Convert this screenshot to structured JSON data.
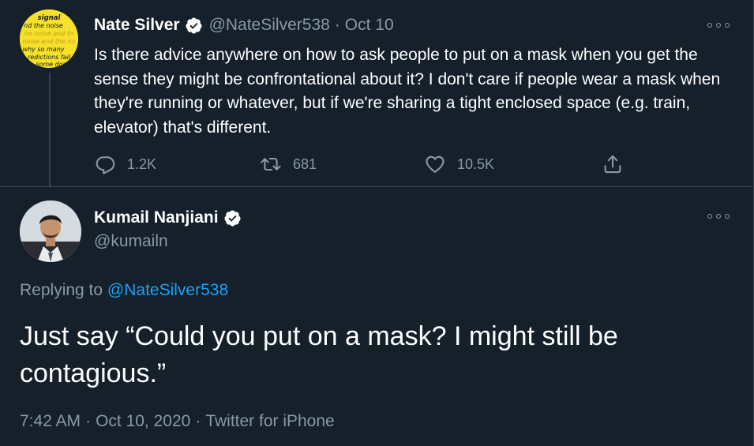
{
  "parent_tweet": {
    "author_name": "Nate Silver",
    "author_handle": "@NateSilver538",
    "separator": "·",
    "date": "Oct 10",
    "avatar_text": [
      "signal",
      "nd the noise",
      "he noise and th",
      "noise and the no",
      "why so many",
      "redictions fail",
      "some don"
    ],
    "text": "Is there advice anywhere on how to ask people to put on a mask when you get the sense they might be confrontational about it? I don't care if people wear a mask when they're running or whatever, but if we're sharing a tight enclosed space (e.g. train, elevator) that's different.",
    "replies": "1.2K",
    "retweets": "681",
    "likes": "10.5K"
  },
  "main_tweet": {
    "author_name": "Kumail Nanjiani",
    "author_handle": "@kumailn",
    "replying_prefix": "Replying to",
    "replying_handle": "@NateSilver538",
    "text": "Just say “Could you put on a mask? I might still be contagious.”",
    "time": "7:42 AM",
    "separator": "·",
    "date": "Oct 10, 2020",
    "source": "Twitter for iPhone"
  },
  "icons": {
    "verified": "verified-badge-icon",
    "reply": "reply-icon",
    "retweet": "retweet-icon",
    "like": "heart-icon",
    "share": "share-icon",
    "more": "more-options-icon"
  },
  "colors": {
    "background": "#15202b",
    "text_primary": "#ffffff",
    "text_secondary": "#8899a6",
    "accent": "#1da1f2",
    "divider": "#38444d",
    "avatar_yellow": "#f5e12a"
  }
}
